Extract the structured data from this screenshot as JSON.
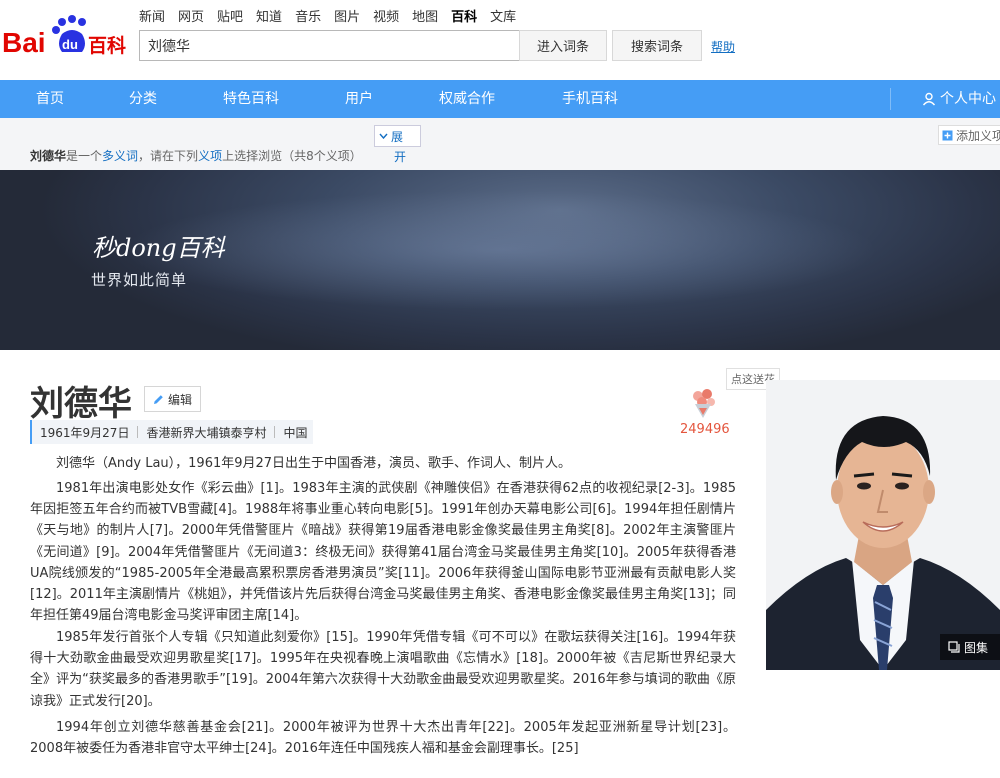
{
  "header": {
    "logo_text": "Bai du 百科",
    "topnav": [
      "新闻",
      "网页",
      "贴吧",
      "知道",
      "音乐",
      "图片",
      "视频",
      "地图",
      "百科",
      "文库"
    ],
    "topnav_active": "百科",
    "search_value": "刘德华",
    "btn_enter": "进入词条",
    "btn_search": "搜索词条",
    "help": "帮助"
  },
  "mainnav": {
    "items": [
      "首页",
      "分类",
      "特色百科",
      "用户",
      "权威合作",
      "手机百科"
    ],
    "user": "个人中心"
  },
  "polysemy": {
    "term": "刘德华",
    "text_a": "是一个",
    "link_a": "多义词",
    "text_b": "，请在下列",
    "link_b": "义项",
    "text_c": "上选择浏览（共8个义项）",
    "expand_a": "展",
    "expand_b": "开",
    "add": "添加义项"
  },
  "banner": {
    "brand": "秒dong百科",
    "slogan": "世界如此简单"
  },
  "entry": {
    "title": "刘德华",
    "edit": "编辑",
    "meta": [
      "1961年9月27日",
      "香港新界大埔镇泰亨村",
      "中国"
    ],
    "flower_count": "249496",
    "flower_tip": "点这送花",
    "album": "图集",
    "p1": "刘德华（Andy Lau），1961年9月27日出生于中国香港，演员、歌手、作词人、制片人。",
    "p2": "1981年出演电影处女作《彩云曲》[1]。1983年主演的武侠剧《神雕侠侣》在香港获得62点的收视纪录[2-3]。1985年因拒签五年合约而被TVB雪藏[4]。1988年将事业重心转向电影[5]。1991年创办天幕电影公司[6]。1994年担任剧情片《天与地》的制片人[7]。2000年凭借警匪片《暗战》获得第19届香港电影金像奖最佳男主角奖[8]。2002年主演警匪片《无间道》[9]。2004年凭借警匪片《无间道3：终极无间》获得第41届台湾金马奖最佳男主角奖[10]。2005年获得香港UA院线颁发的“1985-2005年全港最高累积票房香港男演员”奖[11]。2006年获得釜山国际电影节亚洲最有贡献电影人奖[12]。2011年主演剧情片《桃姐》，并凭借该片先后获得台湾金马奖最佳男主角奖、香港电影金像奖最佳男主角奖[13]；同年担任第49届台湾电影金马奖评审团主席[14]。",
    "p3": "1985年发行首张个人专辑《只知道此刻爱你》[15]。1990年凭借专辑《可不可以》在歌坛获得关注[16]。1994年获得十大劲歌金曲最受欢迎男歌星奖[17]。1995年在央视春晚上演唱歌曲《忘情水》[18]。2000年被《吉尼斯世界纪录大全》评为“获奖最多的香港男歌手”[19]。2004年第六次获得十大劲歌金曲最受欢迎男歌星奖。2016年参与填词的歌曲《原谅我》正式发行[20]。",
    "p4": "1994年创立刘德华慈善基金会[21]。2000年被评为世界十大杰出青年[22]。2005年发起亚洲新星导计划[23]。2008年被委任为香港非官守太平绅士[24]。2016年连任中国残疾人福和基金会副理事长。[25]"
  },
  "colors": {
    "nav_blue": "#459df5",
    "link": "#136ec2",
    "flower": "#e4563e"
  }
}
